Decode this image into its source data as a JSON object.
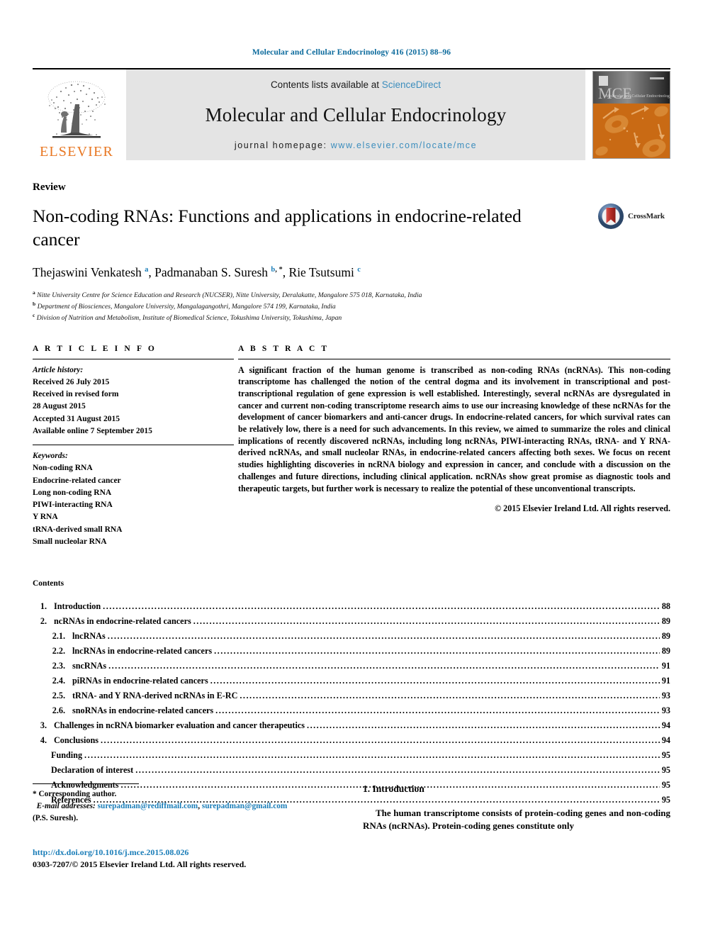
{
  "running_head": "Molecular and Cellular Endocrinology 416 (2015) 88–96",
  "masthead": {
    "publisher_logo_text": "ELSEVIER",
    "contents_prefix": "Contents lists available at ",
    "sciencedirect": "ScienceDirect",
    "journal_name": "Molecular and Cellular Endocrinology",
    "homepage_prefix": "journal homepage: ",
    "homepage_url": "www.elsevier.com/locate/mce",
    "cover_title": "MCE",
    "link_color": "#3b8dbd"
  },
  "article": {
    "doc_type": "Review",
    "title": "Non-coding RNAs: Functions and applications in endocrine-related cancer",
    "crossmark_label": "CrossMark",
    "authors_html": "Thejaswini Venkatesh <sup>a</sup>, Padmanaban S. Suresh <sup>b</sup><sup class=\"star\">, *</sup>, Rie Tsutsumi <sup>c</sup>",
    "affiliations": [
      {
        "marker": "a",
        "text": "Nitte University Centre for Science Education and Research (NUCSER), Nitte University, Deralakatte, Mangalore 575 018, Karnataka, India"
      },
      {
        "marker": "b",
        "text": "Department of Biosciences, Mangalore University, Mangalagangothri, Mangalore 574 199, Karnataka, India"
      },
      {
        "marker": "c",
        "text": "Division of Nutrition and Metabolism, Institute of Biomedical Science, Tokushima University, Tokushima, Japan"
      }
    ]
  },
  "article_info": {
    "heading": "A R T I C L E  I N F O",
    "history_label": "Article history:",
    "history_lines": [
      "Received 26 July 2015",
      "Received in revised form",
      "28 August 2015",
      "Accepted 31 August 2015",
      "Available online 7 September 2015"
    ],
    "keywords_label": "Keywords:",
    "keywords": [
      "Non-coding RNA",
      "Endocrine-related cancer",
      "Long non-coding RNA",
      "PIWI-interacting RNA",
      "Y RNA",
      "tRNA-derived small RNA",
      "Small nucleolar RNA"
    ]
  },
  "abstract": {
    "heading": "A B S T R A C T",
    "body": "A significant fraction of the human genome is transcribed as non-coding RNAs (ncRNAs). This non-coding transcriptome has challenged the notion of the central dogma and its involvement in transcriptional and post-transcriptional regulation of gene expression is well established. Interestingly, several ncRNAs are dysregulated in cancer and current non-coding transcriptome research aims to use our increasing knowledge of these ncRNAs for the development of cancer biomarkers and anti-cancer drugs. In endocrine-related cancers, for which survival rates can be relatively low, there is a need for such advancements. In this review, we aimed to summarize the roles and clinical implications of recently discovered ncRNAs, including long ncRNAs, PIWI-interacting RNAs, tRNA- and Y RNA-derived ncRNAs, and small nucleolar RNAs, in endocrine-related cancers affecting both sexes. We focus on recent studies highlighting discoveries in ncRNA biology and expression in cancer, and conclude with a discussion on the challenges and future directions, including clinical application. ncRNAs show great promise as diagnostic tools and therapeutic targets, but further work is necessary to realize the potential of these unconventional transcripts.",
    "copyright": "© 2015 Elsevier Ireland Ltd. All rights reserved."
  },
  "contents": {
    "heading": "Contents",
    "entries": [
      {
        "num": "1.",
        "label": "Introduction",
        "page": "88",
        "level": 1
      },
      {
        "num": "2.",
        "label": "ncRNAs in endocrine-related cancers",
        "page": "89",
        "level": 1
      },
      {
        "num": "2.1.",
        "label": "lncRNAs",
        "page": "89",
        "level": 2
      },
      {
        "num": "2.2.",
        "label": "lncRNAs in endocrine-related cancers",
        "page": "89",
        "level": 2
      },
      {
        "num": "2.3.",
        "label": "sncRNAs",
        "page": "91",
        "level": 2
      },
      {
        "num": "2.4.",
        "label": "piRNAs in endocrine-related cancers",
        "page": "91",
        "level": 2
      },
      {
        "num": "2.5.",
        "label": "tRNA- and Y RNA-derived ncRNAs in E-RC",
        "page": "93",
        "level": 2
      },
      {
        "num": "2.6.",
        "label": "snoRNAs in endocrine-related cancers",
        "page": "93",
        "level": 2
      },
      {
        "num": "3.",
        "label": "Challenges in ncRNA biomarker evaluation and cancer therapeutics",
        "page": "94",
        "level": 1
      },
      {
        "num": "4.",
        "label": "Conclusions",
        "page": "94",
        "level": 1
      },
      {
        "num": "",
        "label": "Funding",
        "page": "95",
        "level": 3
      },
      {
        "num": "",
        "label": "Declaration of interest",
        "page": "95",
        "level": 3
      },
      {
        "num": "",
        "label": "Acknowledgments",
        "page": "95",
        "level": 3
      },
      {
        "num": "",
        "label": "References",
        "page": "95",
        "level": 3
      }
    ]
  },
  "footer": {
    "corresponding_author": "* Corresponding author.",
    "email_label": "E-mail addresses:",
    "email1": "surepadman@rediffmail.com",
    "email_sep": ",",
    "email2": "surepadman@gmail.com",
    "author_paren": "(P.S. Suresh).",
    "doi": "http://dx.doi.org/10.1016/j.mce.2015.08.026",
    "issn": "0303-7207/© 2015 Elsevier Ireland Ltd. All rights reserved."
  },
  "introduction": {
    "heading": "1.  Introduction",
    "paragraph": "The human transcriptome consists of protein-coding genes and non-coding RNAs (ncRNAs). Protein-coding genes constitute only"
  }
}
